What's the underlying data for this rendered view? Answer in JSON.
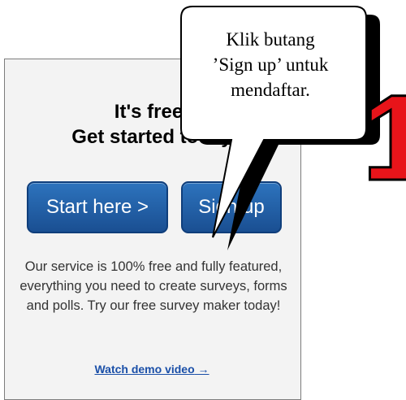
{
  "panel": {
    "headline_line1": "It's free!",
    "headline_line2": "Get started today",
    "start_button_label": "Start here >",
    "signup_button_label": "Sign up",
    "description": "Our service is 100% free and fully featured, everything you need to create surveys, forms and polls. Try our free survey maker today!",
    "demo_link_label": "Watch demo video",
    "demo_link_arrow": "→"
  },
  "callout": {
    "line1": "Klik butang",
    "line2": "’Sign up’ untuk",
    "line3": "mendaftar."
  },
  "step_marker": {
    "number": "1",
    "color": "#e8141a"
  },
  "colors": {
    "button_blue": "#1f5ea8",
    "link_blue": "#1a4fa8",
    "panel_bg": "#f3f3f3"
  }
}
